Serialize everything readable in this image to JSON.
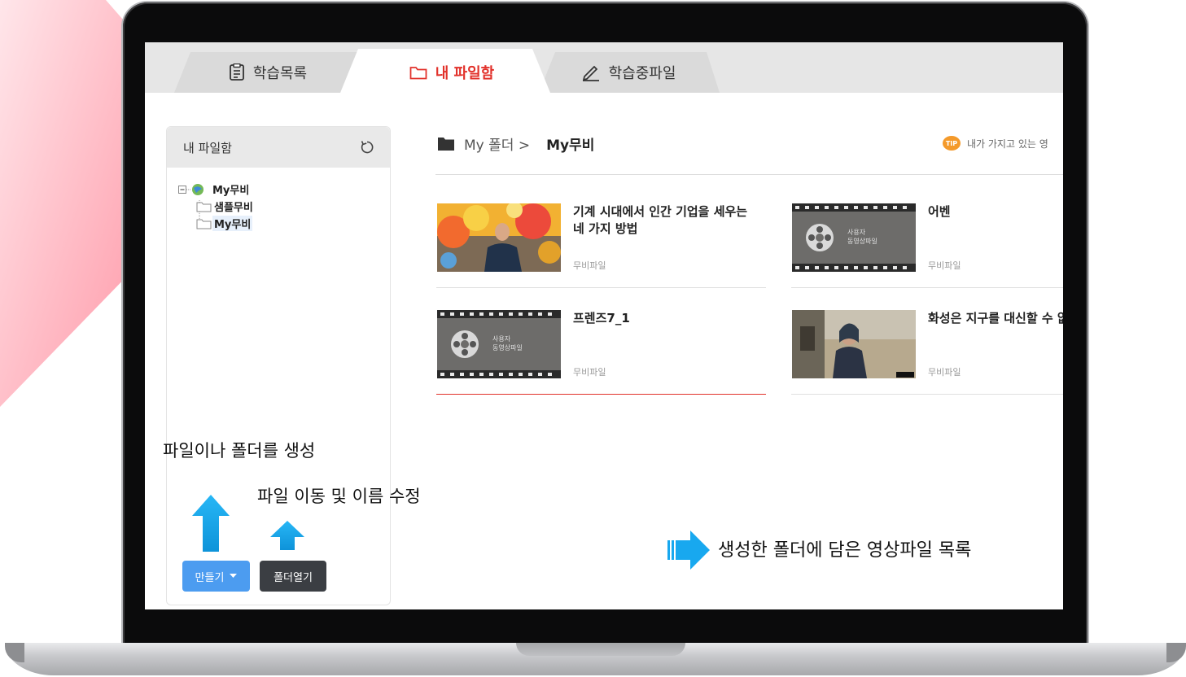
{
  "tabs": [
    {
      "label": "학습목록",
      "icon": "document-icon"
    },
    {
      "label": "내 파일함",
      "icon": "folder-icon",
      "active": true
    },
    {
      "label": "학습중파일",
      "icon": "pencil-icon"
    }
  ],
  "sidebar": {
    "title": "내 파일함",
    "tree": {
      "root": "My무비",
      "children": [
        "샘플무비",
        "My무비"
      ],
      "selected": "My무비"
    },
    "buttons": {
      "make": "만들기",
      "open": "폴더열기"
    }
  },
  "breadcrumb": {
    "parent": "My 폴더 >",
    "current": "My무비"
  },
  "tip": {
    "badge": "TIP",
    "text": "내가 가지고 있는 영"
  },
  "files": [
    {
      "title": "기계 시대에서 인간 기업을 세우는 네 가지 방법",
      "type": "무비파일",
      "thumb": "talk-balloons"
    },
    {
      "title": "어벤",
      "type": "무비파일",
      "thumb": "film-placeholder"
    },
    {
      "title": "프렌즈7_1",
      "type": "무비파일",
      "thumb": "film-placeholder"
    },
    {
      "title": "화성은 지구를 대신할 수 없습니다",
      "type": "무비파일",
      "thumb": "talk-desert"
    }
  ],
  "placeholder_text": {
    "line1": "사용자",
    "line2": "동영상파일"
  },
  "annotations": {
    "create": "파일이나 폴더를 생성",
    "move": "파일 이동 및 이름 수정",
    "list": "생성한 폴더에 담은 영상파일 목록"
  },
  "colors": {
    "accent": "#e2322b",
    "arrow": "#18a8ef",
    "button_blue": "#4c9cf0",
    "button_dark": "#3b3e43"
  }
}
